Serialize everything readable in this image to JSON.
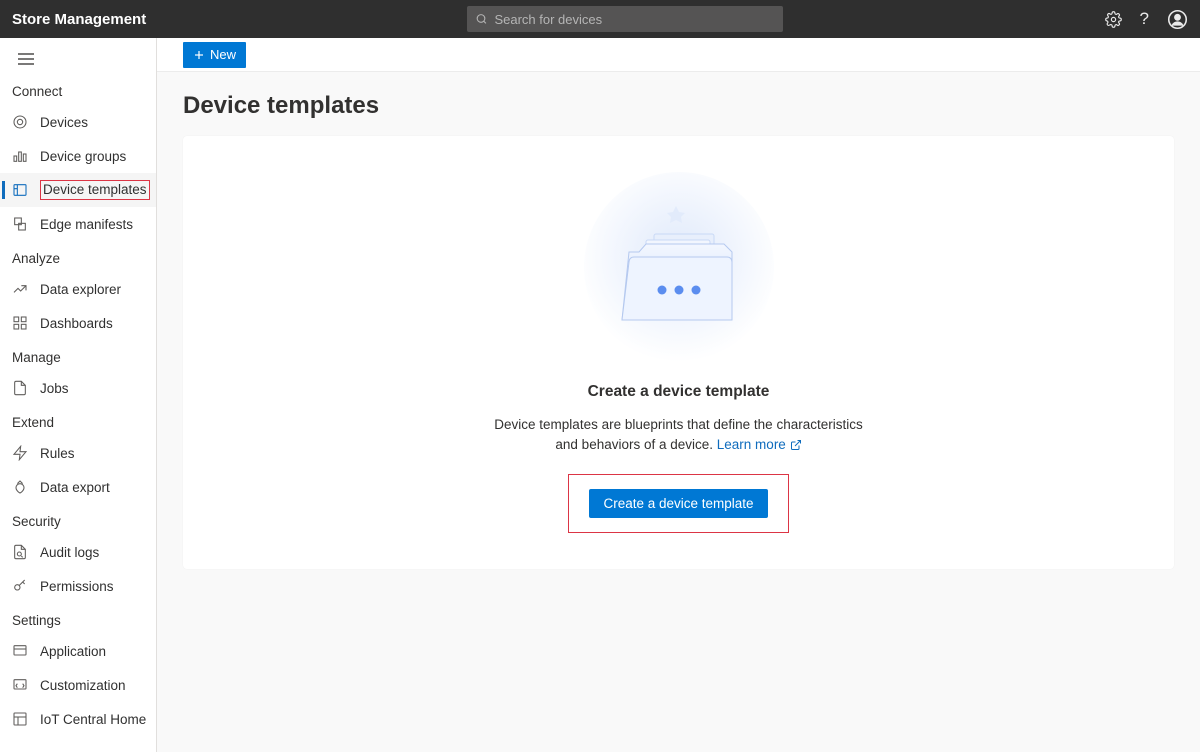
{
  "header": {
    "title": "Store Management",
    "search_placeholder": "Search for devices"
  },
  "toolbar": {
    "new_label": "New"
  },
  "page": {
    "title": "Device templates"
  },
  "empty_state": {
    "title": "Create a device template",
    "description_line1": "Device templates are blueprints that define the characteristics",
    "description_line2": "and behaviors of a device.",
    "learn_more": "Learn more",
    "cta": "Create a device template"
  },
  "sidebar": {
    "sections": [
      {
        "label": "Connect",
        "items": [
          {
            "label": "Devices"
          },
          {
            "label": "Device groups"
          },
          {
            "label": "Device templates",
            "active": true
          },
          {
            "label": "Edge manifests"
          }
        ]
      },
      {
        "label": "Analyze",
        "items": [
          {
            "label": "Data explorer"
          },
          {
            "label": "Dashboards"
          }
        ]
      },
      {
        "label": "Manage",
        "items": [
          {
            "label": "Jobs"
          }
        ]
      },
      {
        "label": "Extend",
        "items": [
          {
            "label": "Rules"
          },
          {
            "label": "Data export"
          }
        ]
      },
      {
        "label": "Security",
        "items": [
          {
            "label": "Audit logs"
          },
          {
            "label": "Permissions"
          }
        ]
      },
      {
        "label": "Settings",
        "items": [
          {
            "label": "Application"
          },
          {
            "label": "Customization"
          },
          {
            "label": "IoT Central Home"
          }
        ]
      }
    ]
  }
}
